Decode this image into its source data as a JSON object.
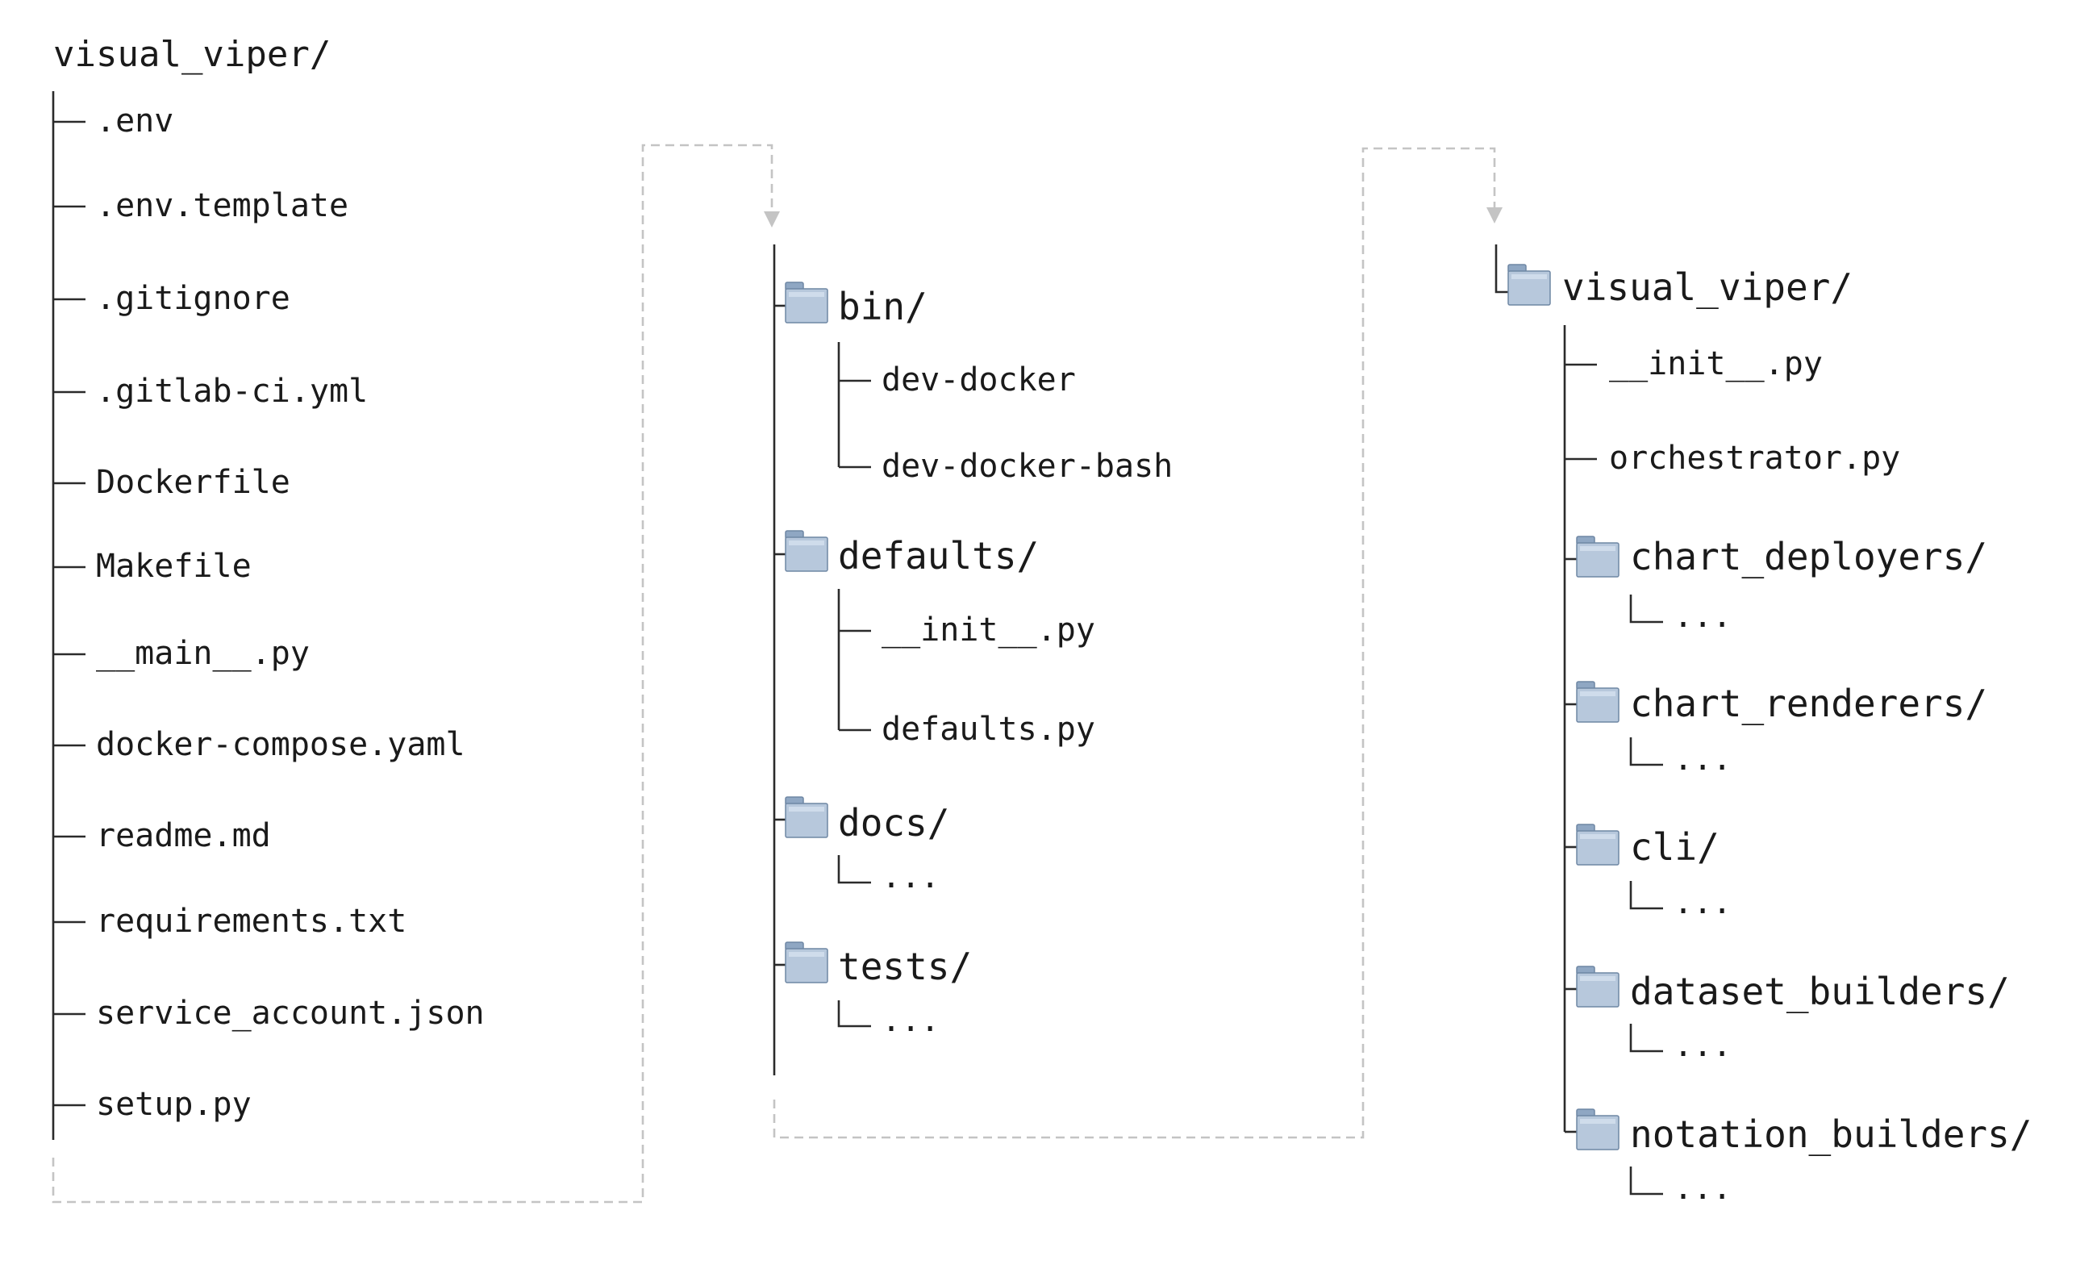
{
  "root": {
    "label": "visual_viper/"
  },
  "column1": {
    "files": [
      ".env",
      ".env.template",
      ".gitignore",
      ".gitlab-ci.yml",
      "Dockerfile",
      "Makefile",
      "__main__.py",
      "docker-compose.yaml",
      "readme.md",
      "requirements.txt",
      "service_account.json",
      "setup.py"
    ]
  },
  "column2": {
    "folders": [
      {
        "name": "bin/",
        "children": [
          "dev-docker",
          "dev-docker-bash"
        ]
      },
      {
        "name": "defaults/",
        "children": [
          "__init__.py",
          "defaults.py"
        ]
      },
      {
        "name": "docs/",
        "children": [
          "..."
        ]
      },
      {
        "name": "tests/",
        "children": [
          "..."
        ]
      }
    ]
  },
  "column3": {
    "package": "visual_viper/",
    "files": [
      "__init__.py",
      "orchestrator.py"
    ],
    "folders": [
      {
        "name": "chart_deployers/",
        "children": [
          "..."
        ]
      },
      {
        "name": "chart_renderers/",
        "children": [
          "..."
        ]
      },
      {
        "name": "cli/",
        "children": [
          "..."
        ]
      },
      {
        "name": "dataset_builders/",
        "children": [
          "..."
        ]
      },
      {
        "name": "notation_builders/",
        "children": [
          "..."
        ]
      }
    ]
  },
  "colors": {
    "tree_line": "#2b2b2b",
    "connector": "#c4c4c4",
    "folder_fill": "#b7c8dc",
    "folder_tab": "#8fa7c3"
  },
  "icons": {
    "folder": "folder-icon"
  }
}
